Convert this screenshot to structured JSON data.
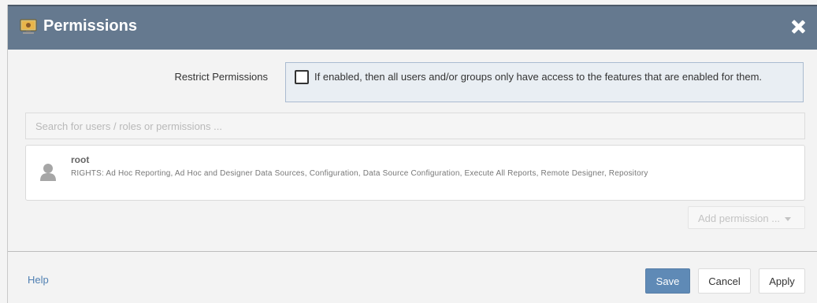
{
  "dialog": {
    "title": "Permissions",
    "title_icon": "monitor-icon",
    "close_icon": "close-icon"
  },
  "restrict": {
    "label": "Restrict Permissions",
    "checked": false,
    "description": "If enabled, then all users and/or groups only have access to the features that are enabled for them."
  },
  "search": {
    "placeholder": "Search for users / roles or permissions ...",
    "value": ""
  },
  "users": [
    {
      "name": "root",
      "rights": "RIGHTS: Ad Hoc Reporting, Ad Hoc and Designer Data Sources, Configuration, Data Source Configuration, Execute All Reports, Remote Designer, Repository",
      "icon": "user-icon"
    }
  ],
  "add_permission": {
    "label": "Add permission ..."
  },
  "footer": {
    "help": "Help",
    "save": "Save",
    "cancel": "Cancel",
    "apply": "Apply"
  },
  "colors": {
    "titlebar": "#65798f",
    "primary_button": "#5f8ab6",
    "link": "#4f7fb2"
  }
}
